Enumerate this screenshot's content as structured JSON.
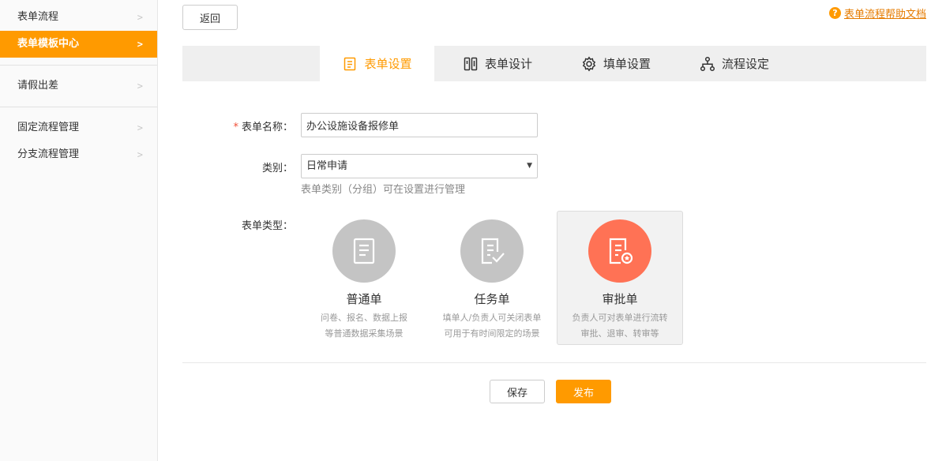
{
  "sidebar": {
    "items": [
      {
        "label": "表单流程"
      },
      {
        "label": "表单模板中心"
      },
      {
        "label": "请假出差"
      },
      {
        "label": "固定流程管理"
      },
      {
        "label": "分支流程管理"
      }
    ],
    "chevron": ">"
  },
  "header": {
    "back_label": "返回",
    "help_icon": "?",
    "help_link": "表单流程帮助文档"
  },
  "tabs": [
    {
      "label": "表单设置",
      "icon": "form-settings-icon"
    },
    {
      "label": "表单设计",
      "icon": "form-design-icon"
    },
    {
      "label": "填单设置",
      "icon": "gear-icon"
    },
    {
      "label": "流程设定",
      "icon": "flow-icon"
    }
  ],
  "form": {
    "name_label": "表单名称：",
    "name_required": "*",
    "name_value": "办公设施设备报修单",
    "category_label": "类别：",
    "category_value": "日常申请",
    "category_hint": "表单类别（分组）可在设置进行管理",
    "type_label": "表单类型：",
    "types": [
      {
        "title": "普通单",
        "desc1": "问卷、报名、数据上报",
        "desc2": "等普通数据采集场景"
      },
      {
        "title": "任务单",
        "desc1": "填单人/负责人可关闭表单",
        "desc2": "可用于有时间限定的场景"
      },
      {
        "title": "审批单",
        "desc1": "负责人可对表单进行流转",
        "desc2": "审批、退审、转审等"
      }
    ]
  },
  "actions": {
    "save_label": "保存",
    "publish_label": "发布"
  },
  "colors": {
    "accent": "#ff9a00",
    "approval": "#ff7255",
    "inactive_circle": "#c4c4c4"
  }
}
